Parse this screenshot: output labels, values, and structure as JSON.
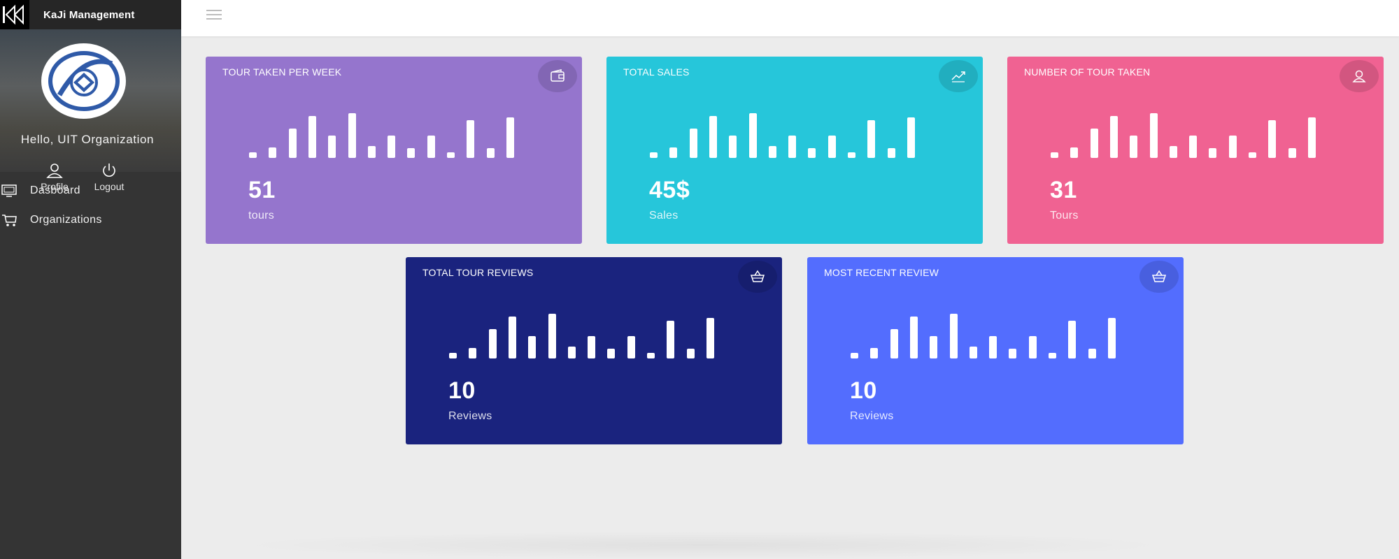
{
  "app": {
    "title": "KaJi Management",
    "user_greeting": "Hello, UIT Organization",
    "actions": [
      {
        "label": "Profile",
        "icon": "user-icon"
      },
      {
        "label": "Logout",
        "icon": "power-icon"
      }
    ]
  },
  "sidebar": {
    "items": [
      {
        "label": "Dasboard",
        "icon": "monitor-icon"
      },
      {
        "label": "Organizations",
        "icon": "cart-icon"
      }
    ]
  },
  "cards": [
    {
      "title": "TOUR TAKEN PER WEEK",
      "value": "51",
      "unit": "tours",
      "icon": "wallet-icon",
      "color": "#9575cd"
    },
    {
      "title": "TOTAL SALES",
      "value": "45$",
      "unit": "Sales",
      "icon": "trending-up-icon",
      "color": "#26c6da"
    },
    {
      "title": "NUMBER OF TOUR TAKEN",
      "value": "31",
      "unit": "Tours",
      "icon": "user-icon",
      "color": "#f06292"
    },
    {
      "title": "TOTAL TOUR REVIEWS",
      "value": "10",
      "unit": "Reviews",
      "icon": "basket-icon",
      "color": "#1a237e"
    },
    {
      "title": "MOST RECENT REVIEW",
      "value": "10",
      "unit": "Reviews",
      "icon": "basket-icon",
      "color": "#536dfe"
    }
  ],
  "sparkline_values": [
    8,
    16,
    43,
    62,
    33,
    66,
    18,
    33,
    14,
    33,
    8,
    56,
    14,
    60
  ]
}
